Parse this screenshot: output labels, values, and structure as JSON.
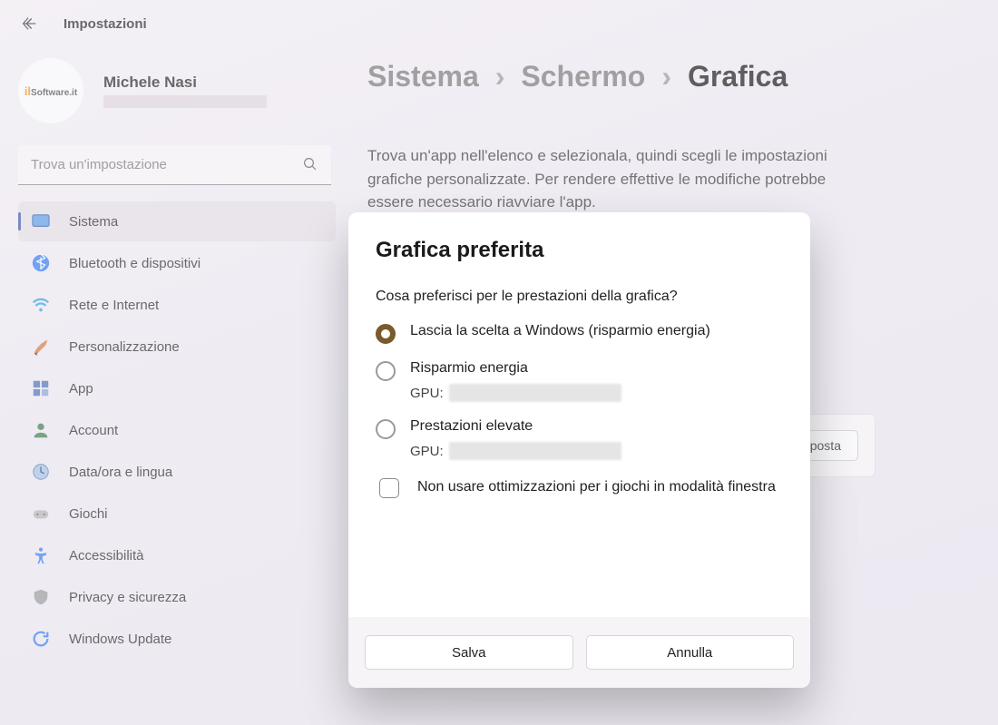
{
  "app": {
    "title": "Impostazioni"
  },
  "user": {
    "name": "Michele Nasi"
  },
  "search": {
    "placeholder": "Trova un'impostazione"
  },
  "sidebar": {
    "items": [
      {
        "label": "Sistema"
      },
      {
        "label": "Bluetooth e dispositivi"
      },
      {
        "label": "Rete e Internet"
      },
      {
        "label": "Personalizzazione"
      },
      {
        "label": "App"
      },
      {
        "label": "Account"
      },
      {
        "label": "Data/ora e lingua"
      },
      {
        "label": "Giochi"
      },
      {
        "label": "Accessibilità"
      },
      {
        "label": "Privacy e sicurezza"
      },
      {
        "label": "Windows Update"
      }
    ]
  },
  "crumbs": {
    "a": "Sistema",
    "b": "Schermo",
    "c": "Grafica"
  },
  "description": "Trova un'app nell'elenco e selezionala, quindi scegli le impostazioni grafiche personalizzate. Per rendere effettive le modifiche potrebbe essere necessario riavviare l'app.",
  "approw": {
    "options_button": "Imposta"
  },
  "appsub": "Lascia la scelta a Windows (risparmio energia)",
  "modal": {
    "title": "Grafica preferita",
    "question": "Cosa preferisci per le prestazioni della grafica?",
    "options": [
      {
        "label": "Lascia la scelta a Windows (risparmio energia)"
      },
      {
        "label": "Risparmio energia",
        "gpu_prefix": "GPU:"
      },
      {
        "label": "Prestazioni elevate",
        "gpu_prefix": "GPU:"
      }
    ],
    "checkbox": "Non usare ottimizzazioni per i giochi in modalità finestra",
    "save": "Salva",
    "cancel": "Annulla"
  }
}
